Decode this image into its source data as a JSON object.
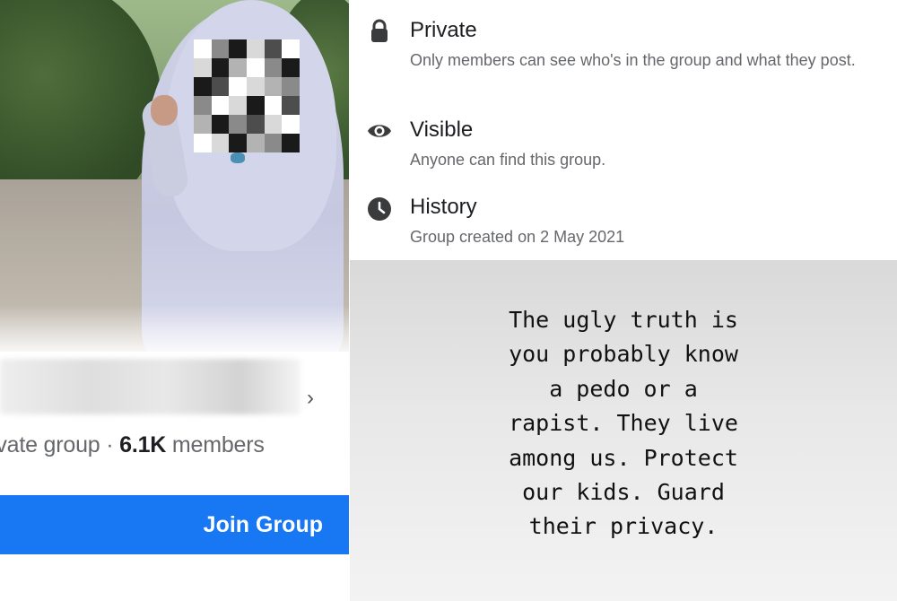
{
  "group_card": {
    "meta_prefix": "ivate group · ",
    "member_count": "6.1K",
    "member_suffix": " members",
    "join_label": "Join Group",
    "chevron_icon": "chevron-right-icon",
    "accent_color": "#1877f2"
  },
  "about": {
    "items": [
      {
        "icon": "lock-icon",
        "title": "Private",
        "description": "Only members can see who's in the group and what they post."
      },
      {
        "icon": "eye-icon",
        "title": "Visible",
        "description": "Anyone can find this group."
      },
      {
        "icon": "clock-icon",
        "title": "History",
        "description": "Group created on 2 May 2021"
      }
    ]
  },
  "quote": {
    "lines": [
      "The ugly truth is",
      "you probably know",
      "a pedo or a",
      "rapist. They live",
      "among us. Protect",
      "our kids. Guard",
      "their privacy."
    ]
  }
}
